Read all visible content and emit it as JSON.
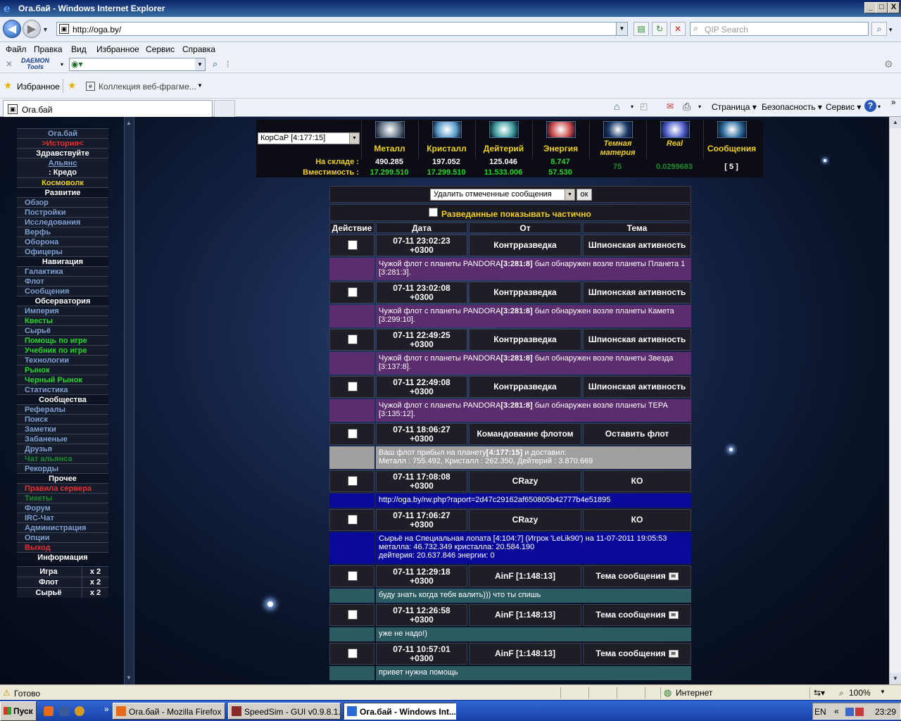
{
  "window": {
    "title": "Ога.бай - Windows Internet Explorer",
    "min": "_",
    "max": "□",
    "close": "X"
  },
  "address": {
    "url": "http://oga.by/"
  },
  "search": {
    "placeholder": "QIP Search"
  },
  "menu": [
    "Файл",
    "Правка",
    "Вид",
    "Избранное",
    "Сервис",
    "Справка"
  ],
  "daemon": {
    "label_line1": "DAEMON",
    "label_line2": "Tools"
  },
  "favorites": {
    "label": "Избранное",
    "collection": "Коллекция веб-фрагме..."
  },
  "tab": {
    "title": "Ога.бай"
  },
  "commandbar": {
    "page": "Страница ▾",
    "safety": "Безопасность ▾",
    "tools": "Сервис ▾"
  },
  "leftmenu": [
    {
      "text": "Ога.бай",
      "style": "link ctr"
    },
    {
      "text": ">История<",
      "style": "red ctr"
    },
    {
      "text": "Здравствуйте",
      "style": "white ctr"
    },
    {
      "text": "Альянс",
      "style": "link ctr u"
    },
    {
      "text": ": Кредо",
      "style": "white ctr n"
    },
    {
      "text": "Космоволк",
      "style": "yellow"
    },
    {
      "text": "Развитие",
      "style": "hdr"
    },
    {
      "text": "Обзор",
      "style": "link"
    },
    {
      "text": "Постройки",
      "style": "link"
    },
    {
      "text": "Исследования",
      "style": "link"
    },
    {
      "text": "Верфь",
      "style": "link"
    },
    {
      "text": "Оборона",
      "style": "link"
    },
    {
      "text": "Офицеры",
      "style": "link"
    },
    {
      "text": "Навигация",
      "style": "hdr"
    },
    {
      "text": "Галактика",
      "style": "link"
    },
    {
      "text": "Флот",
      "style": "link"
    },
    {
      "text": "Сообщения",
      "style": "link"
    },
    {
      "text": "Обсерватория",
      "style": "hdr"
    },
    {
      "text": "Империя",
      "style": "link"
    },
    {
      "text": "Квесты",
      "style": "green"
    },
    {
      "text": "Сырьё",
      "style": "link"
    },
    {
      "text": "Помощь по игре",
      "style": "green"
    },
    {
      "text": "Учебник по игре",
      "style": "green"
    },
    {
      "text": "Технологии",
      "style": "link"
    },
    {
      "text": "Рынок",
      "style": "green"
    },
    {
      "text": "Черный Рынок",
      "style": "green"
    },
    {
      "text": "Статистика",
      "style": "link"
    },
    {
      "text": "Сообщества",
      "style": "hdr"
    },
    {
      "text": "Рефералы",
      "style": "link"
    },
    {
      "text": "Поиск",
      "style": "link"
    },
    {
      "text": "Заметки",
      "style": "link"
    },
    {
      "text": "Забаненые",
      "style": "link"
    },
    {
      "text": "Друзья",
      "style": "link"
    },
    {
      "text": "Чат альянса",
      "style": "dkgreen"
    },
    {
      "text": "Рекорды",
      "style": "link"
    },
    {
      "text": "Прочее",
      "style": "hdr"
    },
    {
      "text": "Правила сервера",
      "style": "red"
    },
    {
      "text": "Тикеты",
      "style": "dkgreen"
    },
    {
      "text": "Форум",
      "style": "link"
    },
    {
      "text": "IRC-Чат",
      "style": "link"
    },
    {
      "text": "Администрация",
      "style": "link"
    },
    {
      "text": "Опции",
      "style": "link"
    },
    {
      "text": "Выход",
      "style": "red"
    },
    {
      "text": "Информация",
      "style": "hdr"
    }
  ],
  "rates": [
    {
      "name": "Игра",
      "mult": "x 2"
    },
    {
      "name": "Флот",
      "mult": "x 2"
    },
    {
      "name": "Сырьё",
      "mult": "x 2"
    }
  ],
  "planet_select": "КорСаР [4:177:15]",
  "resources": {
    "labels": {
      "stock": "На складе :",
      "capacity": "Вместимость :"
    },
    "columns": [
      {
        "name": "Металл",
        "stock": "490.285",
        "cap": "17.299.510",
        "stock_color": "#ffffff",
        "cap_color": "#29d52b",
        "img": "#6a7a8a"
      },
      {
        "name": "Кристалл",
        "stock": "197.052",
        "cap": "17.299.510",
        "stock_color": "#ffffff",
        "cap_color": "#29d52b",
        "img": "#5a9ac8"
      },
      {
        "name": "Дейтерий",
        "stock": "125.046",
        "cap": "11.533.006",
        "stock_color": "#ffffff",
        "cap_color": "#29d52b",
        "img": "#3a9a9a"
      },
      {
        "name": "Энергия",
        "stock": "8.747",
        "cap": "57.530",
        "stock_color": "#29d52b",
        "cap_color": "#29d52b",
        "img": "#c84a4a"
      },
      {
        "name": "Темная материя",
        "stock": "75",
        "cap": "",
        "stock_color": "#1b8a2a",
        "cap_color": "",
        "img": "#1a3a6a",
        "italic": true
      },
      {
        "name": "Real",
        "stock": "0.0299683",
        "cap": "",
        "stock_color": "#1b8a2a",
        "cap_color": "",
        "img": "#4a5ac8",
        "italic": true
      },
      {
        "name": "Сообщения",
        "stock": "[ 5 ]",
        "cap": "",
        "stock_color": "#ffffff",
        "cap_color": "",
        "img": "#2a6a9a"
      }
    ]
  },
  "controls": {
    "bulk_action": "Удалить отмеченные сообщения",
    "ok": "ок",
    "spy_partial": "Разведанные показывать частично"
  },
  "headers": {
    "action": "Действие",
    "date": "Дата",
    "from": "От",
    "subject": "Тема"
  },
  "messages": [
    {
      "date": "07-11 23:02:23\n+0300",
      "from": "Контрразведка",
      "subject": "Шпионская активность",
      "color": "purple",
      "lines": [
        "Чужой флот с планеты PANDORA<b>[3:281:8]</b> был обнаружен возле планеты Планета 1",
        "[3:281:3]."
      ]
    },
    {
      "date": "07-11 23:02:08\n+0300",
      "from": "Контрразведка",
      "subject": "Шпионская активность",
      "color": "purple",
      "lines": [
        "Чужой флот с планеты PANDORA<b>[3:281:8]</b> был обнаружен возле планеты Камета",
        "[3:299:10]."
      ]
    },
    {
      "date": "07-11 22:49:25\n+0300",
      "from": "Контрразведка",
      "subject": "Шпионская активность",
      "color": "purple",
      "lines": [
        "Чужой флот с планеты PANDORA<b>[3:281:8]</b> был обнаружен возле планеты Звезда",
        "[3:137:8]."
      ]
    },
    {
      "date": "07-11 22:49:08\n+0300",
      "from": "Контрразведка",
      "subject": "Шпионская активность",
      "color": "purple",
      "lines": [
        "Чужой флот с планеты PANDORA<b>[3:281:8]</b> был обнаружен возле планеты ТЕРА",
        "[3:135:12]."
      ]
    },
    {
      "date": "07-11 18:06:27\n+0300",
      "from": "Командование флотом",
      "subject": "Оставить флот",
      "color": "gray",
      "lines": [
        "Ваш флот прибыл на планету<b>[4:177:15]</b> и доставил:",
        "Металл : 755.492, Кристалл : 262.350, Дейтерий : 3.870.669"
      ]
    },
    {
      "date": "07-11 17:08:08\n+0300",
      "from": "CRazy",
      "subject": "КО",
      "color": "blue",
      "lines": [
        "http://oga.by/rw.php?raport=2d47c29162af650805b42777b4e51895"
      ]
    },
    {
      "date": "07-11 17:06:27\n+0300",
      "from": "CRazy",
      "subject": "КО",
      "color": "blue",
      "lines": [
        "Сырьё на Специальная лопата [4:104:7] (Игрок 'LeLik90') на 11-07-2011 19:05:53",
        "металла: 46.732.349 кристалла: 20.584.190",
        "дейтерия: 20.637.846 энергии: 0"
      ]
    },
    {
      "date": "07-11 12:29:18\n+0300",
      "from": "AinF [1:148:13]",
      "subject": "Тема сообщения",
      "color": "teal",
      "env": true,
      "lines": [
        "буду знать когда тебя валить))) что ты спишь"
      ]
    },
    {
      "date": "07-11 12:26:58\n+0300",
      "from": "AinF [1:148:13]",
      "subject": "Тема сообщения",
      "color": "teal",
      "env": true,
      "lines": [
        "уже не надо!)"
      ]
    },
    {
      "date": "07-11 10:57:01\n+0300",
      "from": "AinF [1:148:13]",
      "subject": "Тема сообщения",
      "color": "teal",
      "env": true,
      "lines": [
        "привет нужна помощь"
      ]
    }
  ],
  "status": {
    "text": "Готово",
    "zone": "Интернет",
    "zoom": "100%"
  },
  "taskbar": {
    "start": "Пуск",
    "tasks": [
      {
        "label": "Ога.бай - Mozilla Firefox",
        "active": false,
        "color": "#e86a1a"
      },
      {
        "label": "SpeedSim - GUI v0.9.8.1...",
        "active": false,
        "color": "#8a2a2a"
      },
      {
        "label": "Ога.бай - Windows Int...",
        "active": true,
        "color": "#2a6ad8"
      }
    ],
    "lang": "EN",
    "clock": "23:29"
  }
}
